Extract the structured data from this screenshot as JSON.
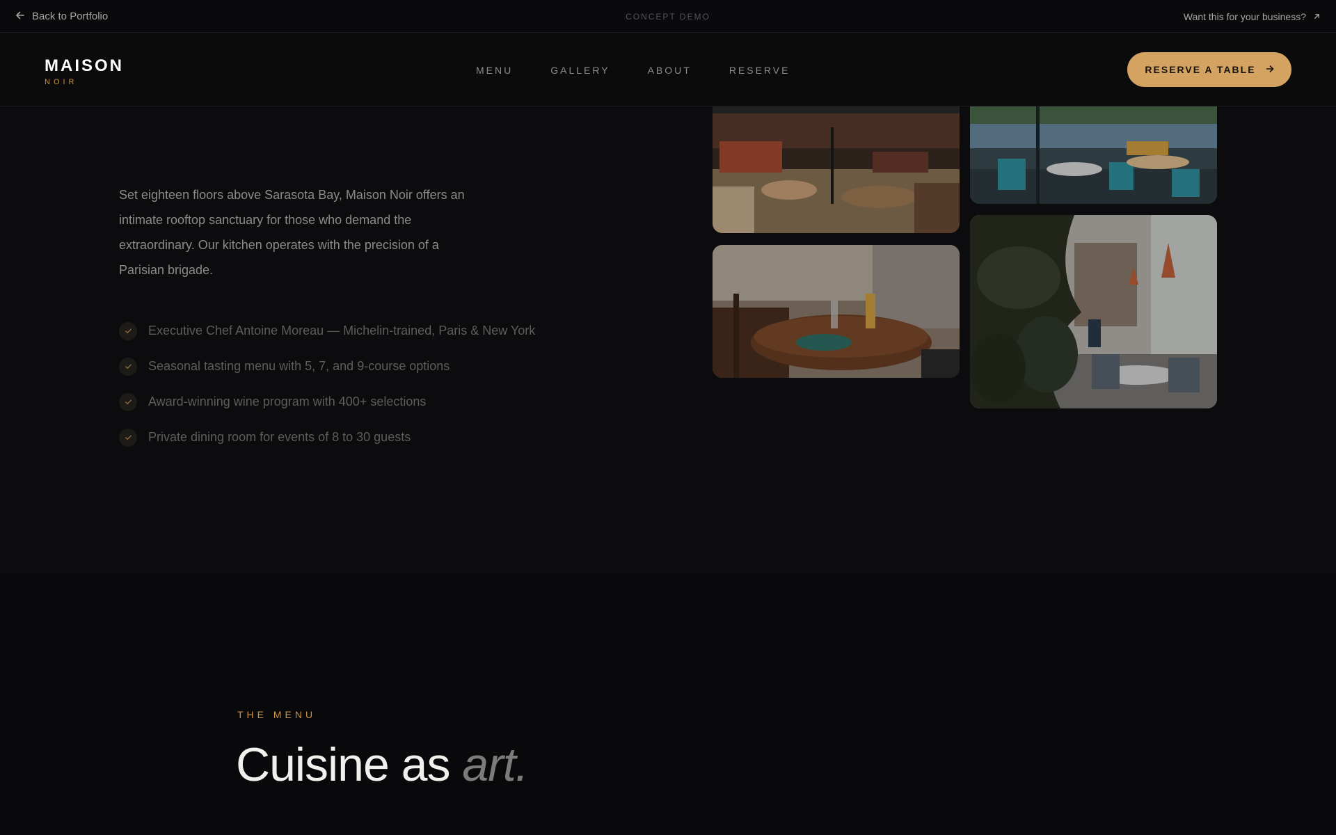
{
  "top_bar": {
    "back_label": "Back to Portfolio",
    "concept_label": "CONCEPT DEMO",
    "business_label": "Want this for your business?"
  },
  "nav": {
    "logo_main": "MAISON",
    "logo_sub": "NOIR",
    "links": [
      "MENU",
      "GALLERY",
      "ABOUT",
      "RESERVE"
    ],
    "cta_label": "RESERVE A TABLE"
  },
  "about": {
    "intro": "Set eighteen floors above Sarasota Bay, Maison Noir offers an intimate rooftop sanctuary for those who demand the extraordinary. Our kitchen operates with the precision of a Parisian brigade.",
    "features": [
      "Executive Chef Antoine Moreau — Michelin-trained, Paris & New York",
      "Seasonal tasting menu with 5, 7, and 9-course options",
      "Award-winning wine program with 400+ selections",
      "Private dining room for events of 8 to 30 guests"
    ],
    "gallery": [
      {
        "name": "restaurant-interior-photo"
      },
      {
        "name": "waterfront-terrace-photo"
      },
      {
        "name": "table-setting-photo"
      },
      {
        "name": "dining-room-plant-photo"
      }
    ]
  },
  "menu": {
    "eyebrow": "THE MENU",
    "heading_main": "Cuisine as ",
    "heading_accent": "art."
  },
  "colors": {
    "accent": "#d4a261",
    "background": "#0b0b0d"
  }
}
